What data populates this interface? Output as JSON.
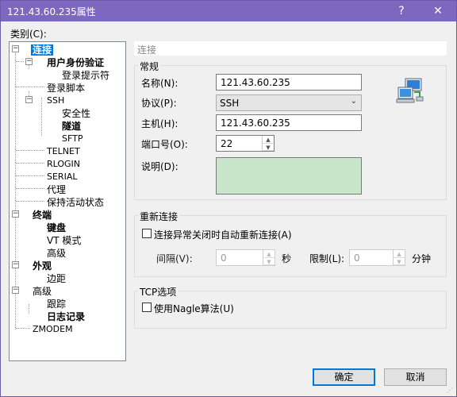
{
  "window": {
    "title": "121.43.60.235属性"
  },
  "titlebar": {
    "help": "?",
    "close": "✕"
  },
  "category_label": "类别(C):",
  "tree": {
    "connection": "连接",
    "auth": "用户身份验证",
    "login_prompt": "登录提示符",
    "login_script": "登录脚本",
    "ssh": "SSH",
    "security": "安全性",
    "tunnel": "隧道",
    "sftp": "SFTP",
    "telnet": "TELNET",
    "rlogin": "RLOGIN",
    "serial": "SERIAL",
    "proxy": "代理",
    "keepalive": "保持活动状态",
    "terminal": "终端",
    "keyboard": "键盘",
    "vt_mode": "VT 模式",
    "advanced_terminal": "高级",
    "appearance": "外观",
    "margin": "边距",
    "advanced": "高级",
    "trace": "跟踪",
    "log": "日志记录",
    "zmodem": "ZMODEM"
  },
  "panel": {
    "header": "连接"
  },
  "general": {
    "legend": "常规",
    "name_label": "名称(N):",
    "name_value": "121.43.60.235",
    "protocol_label": "协议(P):",
    "protocol_value": "SSH",
    "host_label": "主机(H):",
    "host_value": "121.43.60.235",
    "port_label": "端口号(O):",
    "port_value": "22",
    "desc_label": "说明(D):"
  },
  "reconnect": {
    "legend": "重新连接",
    "auto_label": "连接异常关闭时自动重新连接(A)",
    "interval_label": "间隔(V):",
    "interval_value": "0",
    "interval_unit": "秒",
    "limit_label": "限制(L):",
    "limit_value": "0",
    "limit_unit": "分钟"
  },
  "tcp": {
    "legend": "TCP选项",
    "nagle_label": "使用Nagle算法(U)"
  },
  "buttons": {
    "ok": "确定",
    "cancel": "取消"
  }
}
